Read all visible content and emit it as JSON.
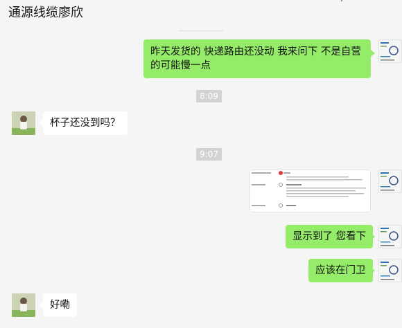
{
  "chat": {
    "title": "通源线缆廖欣"
  },
  "messages": [
    {
      "from": "me",
      "text": "昨天发货的 快递路由还没动 我来问下 不是自营的可能慢一点"
    },
    {
      "type": "time",
      "text": "8:09"
    },
    {
      "from": "them",
      "text": "杯子还没到吗？"
    },
    {
      "type": "time",
      "text": "9:07"
    },
    {
      "from": "me",
      "type": "image",
      "alt": "物流信息截图"
    },
    {
      "from": "me",
      "text": "显示到了 您看下"
    },
    {
      "from": "me",
      "text": "应该在门卫"
    },
    {
      "from": "them",
      "text": "好嘞"
    }
  ],
  "colors": {
    "my_bubble": "#95ec69",
    "their_bubble": "#ffffff",
    "background": "#f5f5f5"
  }
}
